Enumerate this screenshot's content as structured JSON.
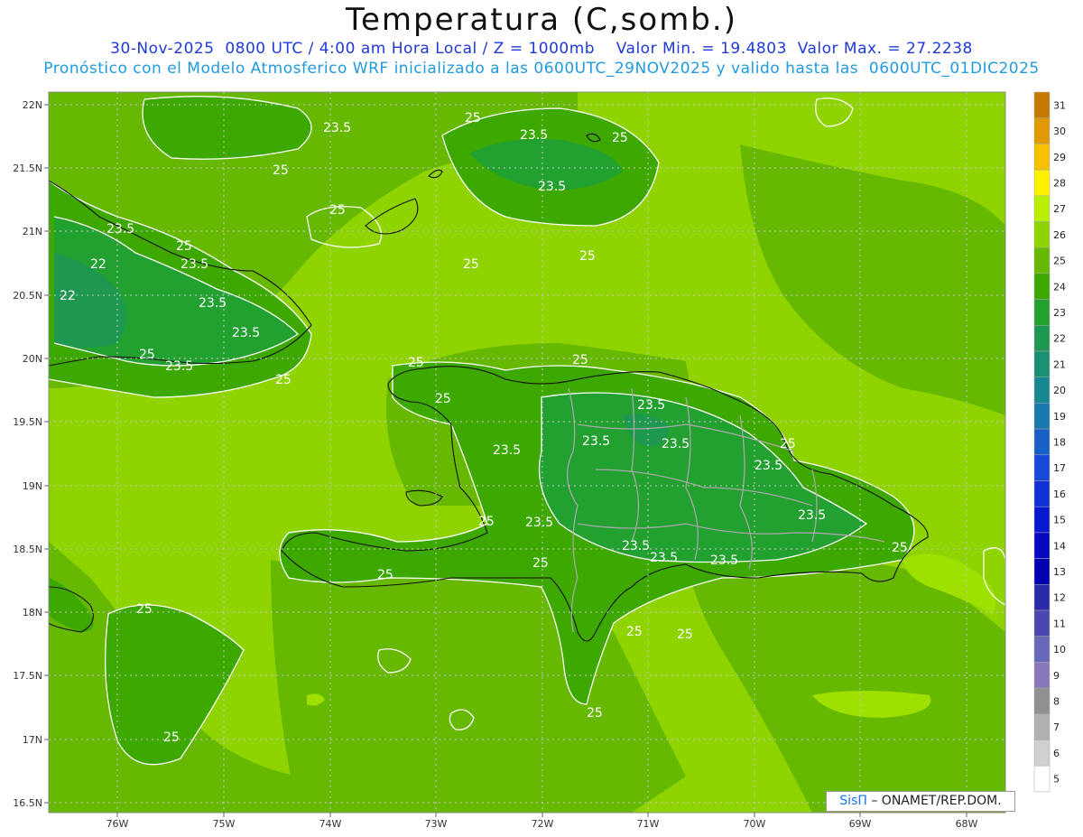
{
  "header": {
    "title": "Temperatura (C,somb.)",
    "line1": "30-Nov-2025  0800 UTC / 4:00 am Hora Local / Z = 1000mb    Valor Min. = 19.4803  Valor Max. = 27.2238",
    "line2": "Pronóstico con el Modelo Atmosferico WRF inicializado a las 0600UTC_29NOV2025 y valido hasta las  0600UTC_01DIC2025"
  },
  "axes": {
    "lat_labels": [
      "22N",
      "21.5N",
      "21N",
      "20.5N",
      "20N",
      "19.5N",
      "19N",
      "18.5N",
      "18N",
      "17.5N",
      "17N",
      "16.5N"
    ],
    "lon_labels": [
      "76W",
      "75W",
      "74W",
      "73W",
      "72W",
      "71W",
      "70W",
      "69W",
      "68W"
    ]
  },
  "colorbar": {
    "levels": [
      "31",
      "30",
      "29",
      "28",
      "27",
      "26",
      "25",
      "24",
      "23",
      "22",
      "21",
      "20",
      "19",
      "18",
      "17",
      "16",
      "15",
      "14",
      "13",
      "12",
      "11",
      "10",
      "9",
      "8",
      "7",
      "6",
      "5"
    ],
    "colors": [
      "#c47a00",
      "#e09a00",
      "#f5c000",
      "#fff000",
      "#b8f000",
      "#8fd400",
      "#66b800",
      "#3ca800",
      "#22a030",
      "#1e9850",
      "#1a9070",
      "#188890",
      "#1878b0",
      "#1860c8",
      "#1848d8",
      "#1030d8",
      "#0818d0",
      "#0808c0",
      "#0000b0",
      "#2a2aa8",
      "#4848b0",
      "#6868b8",
      "#8878b8",
      "#909090",
      "#b0b0b0",
      "#d0d0d0",
      "#ffffff"
    ]
  },
  "contour_labels": [
    "25",
    "23.5",
    "22"
  ],
  "credit": {
    "sis": "SisΠ",
    "text": "– ONAMET/REP.DOM."
  },
  "colors": {
    "ocean": "#8fd400",
    "ocean_warm": "#9ee000",
    "mid": "#66b800",
    "land": "#3ca800",
    "cool": "#22a030",
    "coolest": "#1e9850",
    "title_blue": "#1f3ad6",
    "subtitle_blue": "#1f9be0"
  }
}
